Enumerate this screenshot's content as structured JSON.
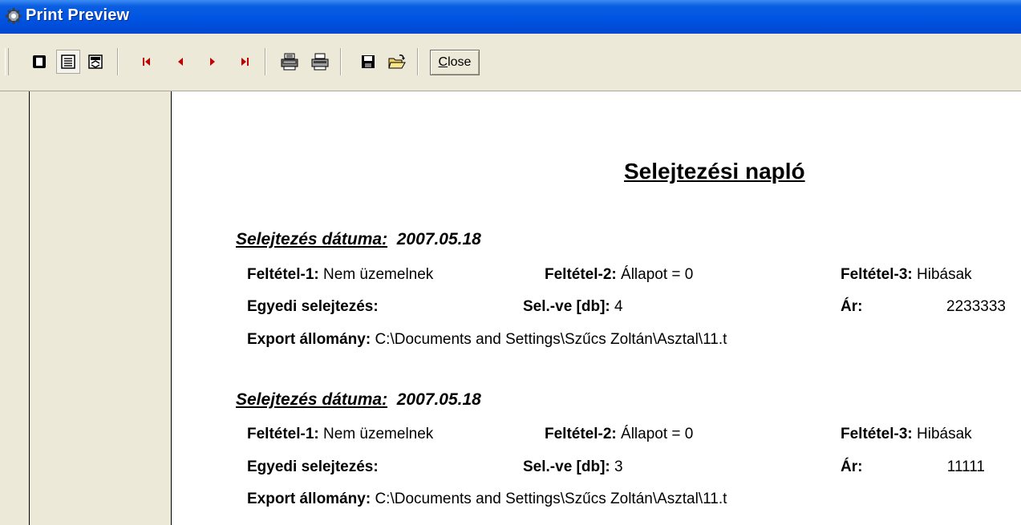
{
  "window": {
    "title": "Print Preview"
  },
  "toolbar": {
    "buttons": [
      {
        "name": "whole-page-icon"
      },
      {
        "name": "page-width-icon"
      },
      {
        "name": "zoom-icon"
      },
      {
        "name": "first-page-icon"
      },
      {
        "name": "previous-page-icon"
      },
      {
        "name": "next-page-icon"
      },
      {
        "name": "last-page-icon"
      },
      {
        "name": "printer-setup-icon"
      },
      {
        "name": "print-icon"
      },
      {
        "name": "save-icon"
      },
      {
        "name": "open-icon"
      }
    ],
    "close_label_underlined": "C",
    "close_label_rest": "lose"
  },
  "report": {
    "title": "Selejtezési napló",
    "records": [
      {
        "date_label": "Selejtezés dátuma:",
        "date": "2007.05.18",
        "cond1_label": "Feltétel-1:",
        "cond1": "Nem üzemelnek",
        "cond2_label": "Feltétel-2:",
        "cond2": "Állapot = 0",
        "cond3_label": "Feltétel-3:",
        "cond3": "Hibásak",
        "single_label": "Egyedi selejtezés:",
        "count_label": "Sel.-ve [db]:",
        "count": "4",
        "price_label": "Ár:",
        "price": "2233333",
        "export_label": "Export állomány:",
        "export": "C:\\Documents and Settings\\Szűcs Zoltán\\Asztal\\11.t"
      },
      {
        "date_label": "Selejtezés dátuma:",
        "date": "2007.05.18",
        "cond1_label": "Feltétel-1:",
        "cond1": "Nem üzemelnek",
        "cond2_label": "Feltétel-2:",
        "cond2": "Állapot = 0",
        "cond3_label": "Feltétel-3:",
        "cond3": "Hibásak",
        "single_label": "Egyedi selejtezés:",
        "count_label": "Sel.-ve [db]:",
        "count": "3",
        "price_label": "Ár:",
        "price": "11111",
        "export_label": "Export állomány:",
        "export": "C:\\Documents and Settings\\Szűcs Zoltán\\Asztal\\11.t"
      }
    ]
  },
  "colors": {
    "titlebar": "#0054e3",
    "toolbar": "#ece9d8",
    "page": "#ffffff",
    "nav_arrows": "#c00000"
  }
}
